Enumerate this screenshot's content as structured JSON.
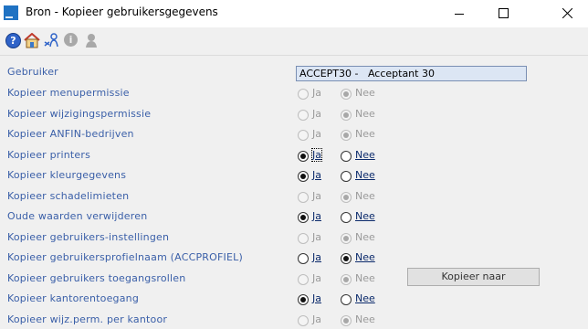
{
  "window": {
    "title": "Bron - Kopieer gebruikersgegevens"
  },
  "toolbar": {
    "icons": [
      "help-icon",
      "home-icon",
      "user-link-icon",
      "info-icon",
      "person-icon"
    ],
    "help_glyph": "?",
    "info_glyph": "i"
  },
  "user_field": {
    "label": "Gebruiker",
    "value": "ACCEPT30 -   Acceptant 30"
  },
  "radio_labels": {
    "yes": "Ja",
    "no": "Nee"
  },
  "rows": [
    {
      "label": "Kopieer menupermissie",
      "selected": "nee",
      "enabled": false
    },
    {
      "label": "Kopieer wijzigingspermissie",
      "selected": "nee",
      "enabled": false
    },
    {
      "label": "Kopieer ANFIN-bedrijven",
      "selected": "nee",
      "enabled": false
    },
    {
      "label": "Kopieer printers",
      "selected": "ja",
      "enabled": true
    },
    {
      "label": "Kopieer kleurgegevens",
      "selected": "ja",
      "enabled": true
    },
    {
      "label": "Kopieer schadelimieten",
      "selected": "nee",
      "enabled": false
    },
    {
      "label": "Oude waarden verwijderen",
      "selected": "ja",
      "enabled": true
    },
    {
      "label": "Kopieer gebruikers-instellingen",
      "selected": "nee",
      "enabled": false
    },
    {
      "label": "Kopieer gebruikersprofielnaam (ACCPROFIEL)",
      "selected": "nee",
      "enabled": true
    },
    {
      "label": "Kopieer gebruikers toegangsrollen",
      "selected": "nee",
      "enabled": false
    },
    {
      "label": "Kopieer kantorentoegang",
      "selected": "ja",
      "enabled": true
    },
    {
      "label": "Kopieer wijz.perm. per kantoor",
      "selected": "nee",
      "enabled": false
    }
  ],
  "copy_button": {
    "label": "Kopieer naar"
  }
}
